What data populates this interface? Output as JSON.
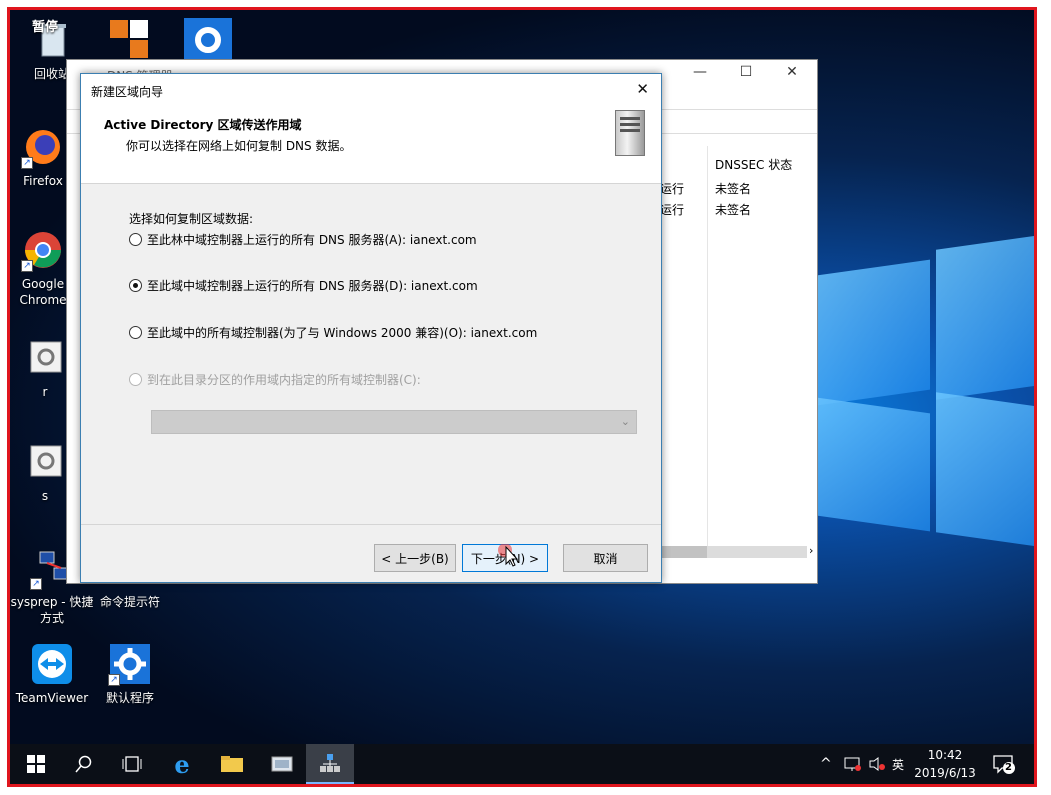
{
  "desktop": {
    "icons": [
      {
        "label": "回收站",
        "icon": "recycle-bin-icon"
      },
      {
        "label": "Firefox",
        "icon": "firefox-icon"
      },
      {
        "label": "Google Chrome",
        "icon": "chrome-icon"
      },
      {
        "label": "r",
        "icon": "settings-file-icon"
      },
      {
        "label": "s",
        "icon": "settings-file-icon"
      },
      {
        "label": "sysprep - 快捷方式",
        "icon": "network-shortcut-icon"
      },
      {
        "label": "命令提示符",
        "icon": "cmd-icon"
      },
      {
        "label": "TeamViewer",
        "icon": "teamviewer-icon"
      },
      {
        "label": "默认程序",
        "icon": "default-programs-icon"
      }
    ],
    "overlay_text": "暂停"
  },
  "dns_window": {
    "title": "DNS 管理器",
    "column_header": "DNSSEC 状态",
    "rows": [
      {
        "status": "运行",
        "dnssec": "未签名"
      },
      {
        "status": "运行",
        "dnssec": "未签名"
      }
    ]
  },
  "wizard": {
    "title": "新建区域向导",
    "heading": "Active Directory 区域传送作用域",
    "subheading": "你可以选择在网络上如何复制 DNS 数据。",
    "prompt": "选择如何复制区域数据:",
    "options": [
      {
        "label": "至此林中域控制器上运行的所有 DNS 服务器(A): ianext.com",
        "checked": false,
        "disabled": false
      },
      {
        "label": "至此域中域控制器上运行的所有 DNS 服务器(D): ianext.com",
        "checked": true,
        "disabled": false
      },
      {
        "label": "至此域中的所有域控制器(为了与 Windows 2000 兼容)(O): ianext.com",
        "checked": false,
        "disabled": false
      },
      {
        "label": "到在此目录分区的作用域内指定的所有域控制器(C):",
        "checked": false,
        "disabled": true
      }
    ],
    "partition_select_value": "",
    "buttons": {
      "back": "< 上一步(B)",
      "next": "下一步(N) >",
      "cancel": "取消"
    }
  },
  "taskbar": {
    "ime": "英",
    "time": "10:42",
    "date": "2019/6/13",
    "notification_count": "2"
  }
}
